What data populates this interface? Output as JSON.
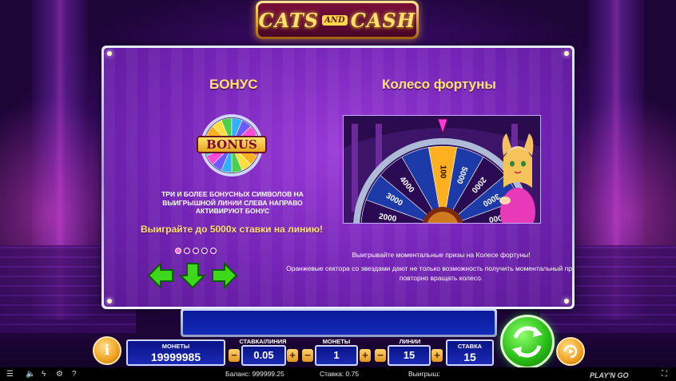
{
  "logo": {
    "word1": "CATS",
    "and": "AND",
    "word2": "CASH"
  },
  "paytable": {
    "bonus_heading": "БОНУС",
    "bonus_symbol_label": "BONUS",
    "bonus_text": "ТРИ И БОЛЕЕ БОНУСНЫХ СИМВОЛОВ НА ВЫИГРЫШНОЙ ЛИНИИ СЛЕВА НАПРАВО АКТИВИРУЮТ БОНУС",
    "bonus_win": "Выиграйте до 5000х ставки на линию!",
    "wheel_heading": "Колесо фортуны",
    "wheel_values": [
      "2000",
      "3000",
      "4000",
      "100",
      "5000",
      "2000",
      "3000",
      "5000",
      "2000"
    ],
    "wheel_text_1": "Выигрывайте моментальные призы на Колесе фортуны!",
    "wheel_text_2": "Оранжевые сектора со звездами дают не только возможность получить моментальный приз, но и повторно вращать колесо.",
    "pages": 5,
    "active_page": 1
  },
  "controls": {
    "coins_label": "МОНЕТЫ",
    "coins_value": "19999985",
    "bet_per_line_label": "СТАВКА/ЛИНИЯ",
    "bet_per_line_value": "0.05",
    "coins_per_line_label": "МОНЕТЫ",
    "coins_per_line_value": "1",
    "lines_label": "ЛИНИИ",
    "lines_value": "15",
    "bet_label": "СТАВКА",
    "bet_value": "15",
    "minus": "−",
    "plus": "+",
    "info": "i"
  },
  "status_bar": {
    "balance": "Баланс: 999999.25",
    "bet": "Ставка: 0.75",
    "win": "Выигрыш:",
    "provider": "PLAY'N GO"
  },
  "colors": {
    "accent": "#ffe36a",
    "panel": "#7424b6",
    "spin": "#2cc01a"
  }
}
